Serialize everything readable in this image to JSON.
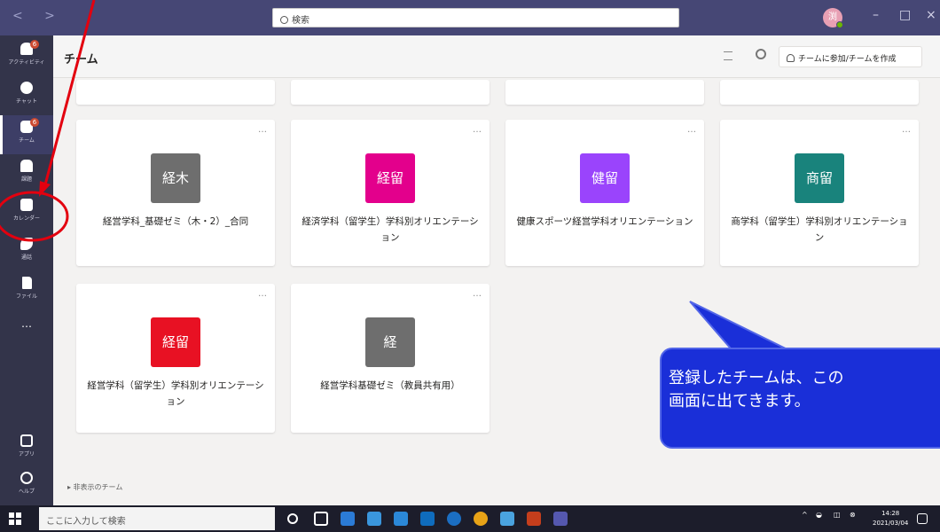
{
  "titlebar": {
    "nav": "< >",
    "search_placeholder": "検索",
    "avatar_initial": "渕",
    "min": "–",
    "max": "□",
    "close": "×"
  },
  "rail": {
    "items": [
      {
        "label": "アクティビティ",
        "badge": "6"
      },
      {
        "label": "チャット",
        "badge": ""
      },
      {
        "label": "チーム",
        "badge": "6"
      },
      {
        "label": "課題",
        "badge": ""
      },
      {
        "label": "カレンダー",
        "badge": ""
      },
      {
        "label": "通話",
        "badge": ""
      },
      {
        "label": "ファイル",
        "badge": ""
      }
    ],
    "more": "…",
    "apps_label": "アプリ",
    "help_label": "ヘルプ"
  },
  "header": {
    "title": "チーム",
    "join_label": "チームに参加/チームを作成"
  },
  "cards": [
    {
      "abbr": "経木",
      "color": "#6e6e6e",
      "name": "経営学科_基礎ゼミ（木・2）_合同"
    },
    {
      "abbr": "経留",
      "color": "#e3008c",
      "name": "経済学科（留学生）学科別オリエンテーション"
    },
    {
      "abbr": "健留",
      "color": "#9a44fc",
      "name": "健康スポーツ経営学科オリエンテーション"
    },
    {
      "abbr": "商留",
      "color": "#19837c",
      "name": "商学科（留学生）学科別オリエンテーション"
    },
    {
      "abbr": "経留",
      "color": "#e81123",
      "name": "経営学科（留学生）学科別オリエンテーション"
    },
    {
      "abbr": "経",
      "color": "#6e6e6e",
      "name": "経営学科基礎ゼミ（教員共有用）"
    }
  ],
  "card_menu": "…",
  "hidden_teams": "▸ 非表示のチーム",
  "callout": {
    "line1": "登録したチームは、この",
    "line2": "画面に出てきます。"
  },
  "taskbar": {
    "search_placeholder": "ここに入力して検索",
    "time": "14:28",
    "date": "2021/03/04"
  },
  "colors": {
    "titlebar": "#464775",
    "rail": "#33344a",
    "callout": "#1a2fd8",
    "annotation": "#e3000f"
  }
}
